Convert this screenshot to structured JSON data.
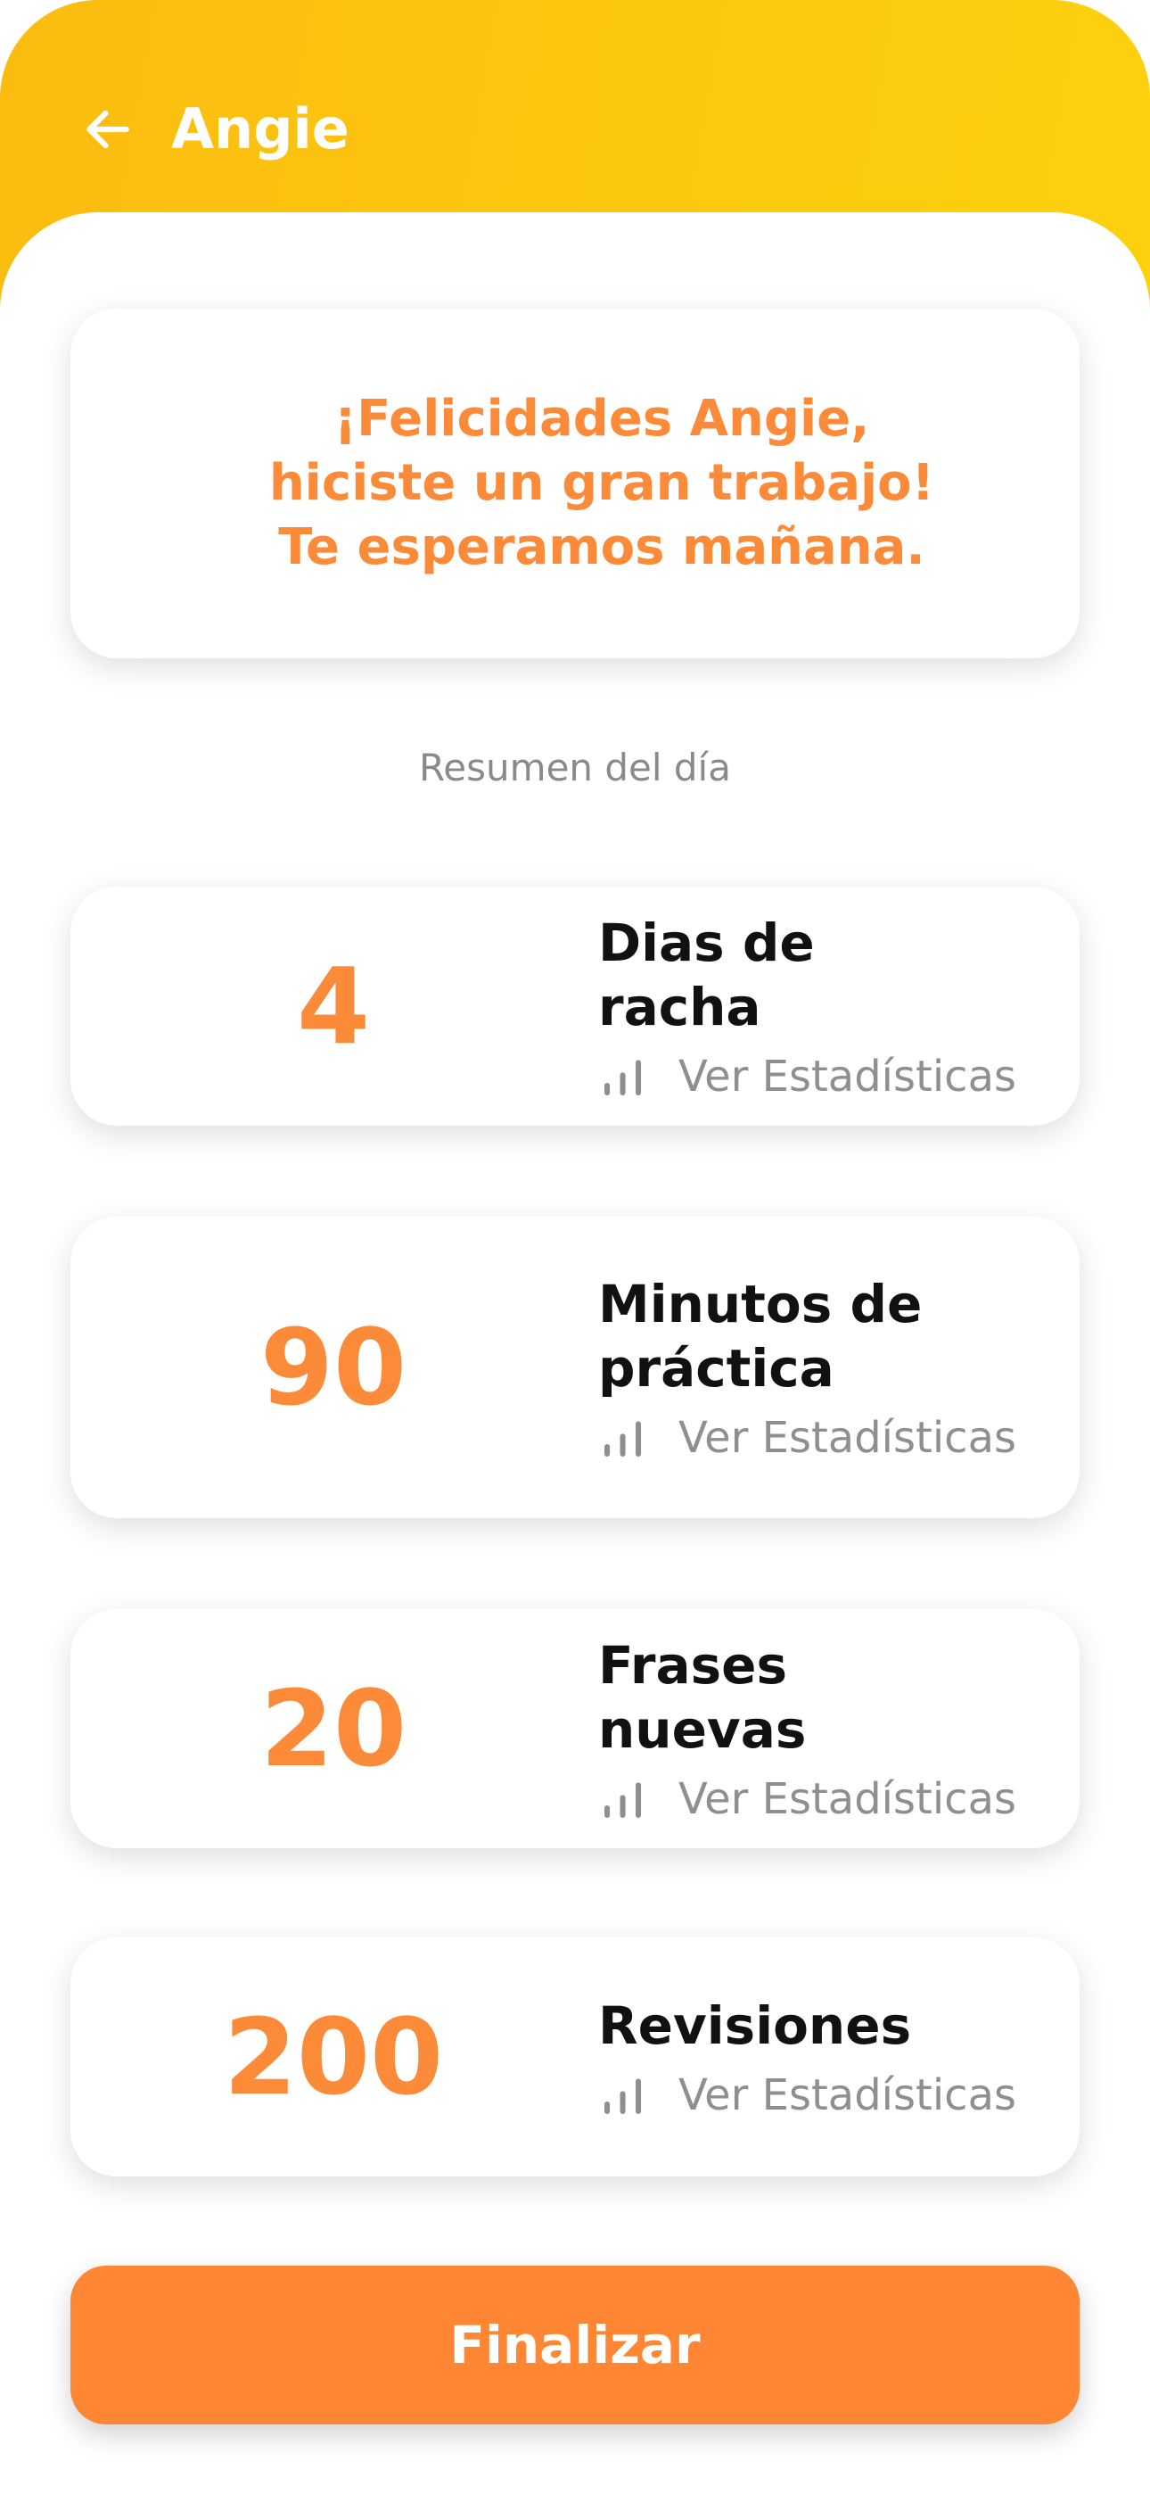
{
  "header": {
    "title": "Angie",
    "back_icon": "arrow-left-icon"
  },
  "congrats": {
    "line1": "¡Felicidades Angie,",
    "line2": "hiciste un gran trabajo!",
    "line3": "Te esperamos mañana."
  },
  "summary": {
    "label": "Resumen del día"
  },
  "stats": [
    {
      "value": "4",
      "title": "Dias de racha",
      "link": "Ver Estadísticas",
      "icon": "bar-chart-icon"
    },
    {
      "value": "90",
      "title": "Minutos de práctica",
      "link": "Ver Estadísticas",
      "icon": "bar-chart-icon"
    },
    {
      "value": "20",
      "title": "Frases nuevas",
      "link": "Ver Estadísticas",
      "icon": "bar-chart-icon"
    },
    {
      "value": "200",
      "title": "Revisiones",
      "link": "Ver Estadísticas",
      "icon": "bar-chart-icon"
    }
  ],
  "footer": {
    "button_label": "Finalizar"
  },
  "colors": {
    "header_gradient_start": "#FBBC10",
    "header_gradient_end": "#FDD10E",
    "accent_orange": "#FB8A39",
    "button_orange": "#FF8734",
    "title_text": "#111111",
    "muted_text": "#8f8f8f"
  }
}
